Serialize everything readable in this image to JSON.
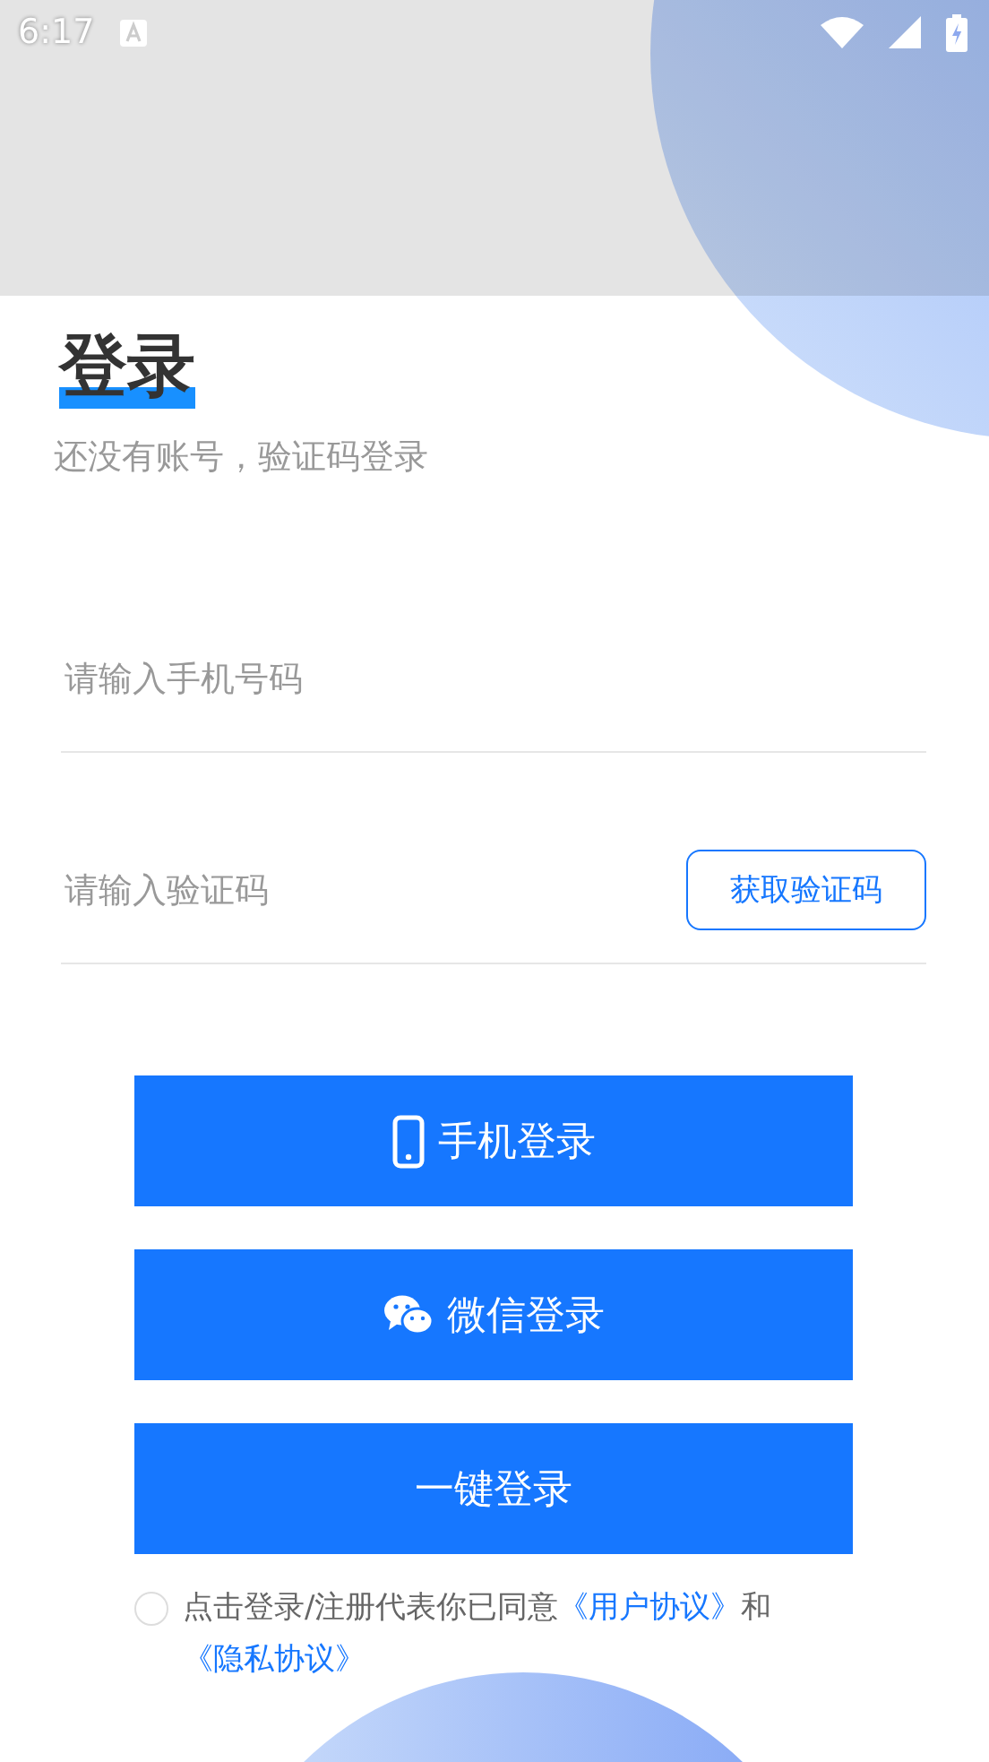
{
  "status_bar": {
    "time": "6:17"
  },
  "title": "登录",
  "subtitle": "还没有账号，验证码登录",
  "fields": [
    {
      "placeholder": "请输入手机号码"
    },
    {
      "placeholder": "请输入验证码",
      "action": "获取验证码"
    }
  ],
  "buttons": [
    {
      "kind": "phone",
      "label": "手机登录"
    },
    {
      "kind": "wechat",
      "label": "微信登录"
    },
    {
      "kind": "plain",
      "label": "一键登录"
    }
  ],
  "agreement": {
    "checked": false,
    "text": "点击登录/注册代表你已同意",
    "links": [
      "《用户协议》",
      "《隐私协议》"
    ],
    "joiner": "和"
  }
}
